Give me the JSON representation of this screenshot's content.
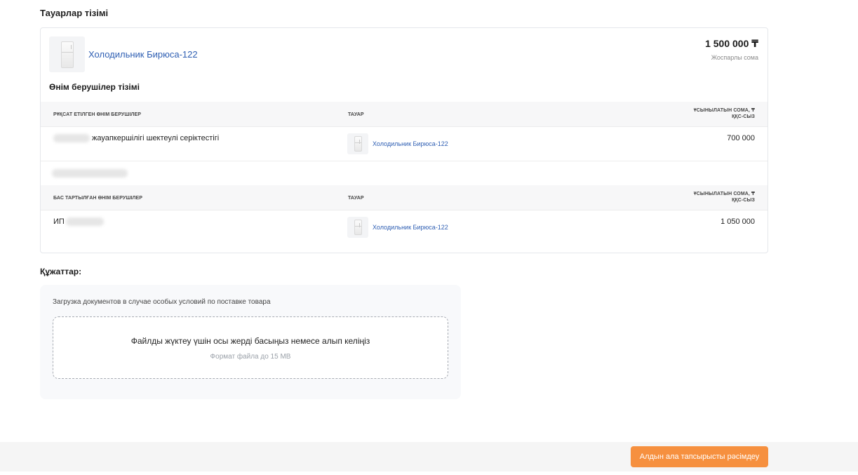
{
  "products_section": {
    "title": "Тауарлар тізімі"
  },
  "product": {
    "name": "Холодильник Бирюса-122",
    "planned_amount": "1 500 000 ₸",
    "planned_amount_caption": "Жоспарлы сома",
    "icon": "fridge-icon"
  },
  "suppliers": {
    "title": "Өнім берушілер тізімі",
    "allowed": {
      "headers": [
        "РҰҚСАТ ЕТІЛГЕН ӨНІМ БЕРУШІЛЕР",
        "ТАУАР",
        "ҰСЫНЫЛАТЫН СОМА, ₸",
        "ҚҚС-СЫЗ"
      ],
      "rows": [
        {
          "supplier": "жауапкершілігі шектеулі серіктестігі",
          "product": "Холодильник Бирюса-122",
          "amount": "700 000"
        }
      ]
    },
    "declined": {
      "headers": [
        "БАС ТАРТЫЛҒАН ӨНІМ БЕРУШІЛЕР",
        "ТАУАР",
        "ҰСЫНЫЛАТЫН СОМА, ₸",
        "ҚҚС-СЫЗ"
      ],
      "rows": [
        {
          "supplier": "ИП",
          "product": "Холодильник Бирюса-122",
          "amount": "1 050 000"
        }
      ]
    }
  },
  "documents": {
    "title": "Құжаттар:",
    "caption": "Загрузка документов в случае особых условий по поставке товара",
    "dropzone_main": "Файлды жүктеу үшін осы жерді басыңыз немесе алып келіңіз",
    "dropzone_sub": "Формат файла до 15 MB"
  },
  "footer": {
    "submit_label": "Алдын ала тапсырысты рәсімдеу",
    "accent_color": "#f6903f"
  }
}
